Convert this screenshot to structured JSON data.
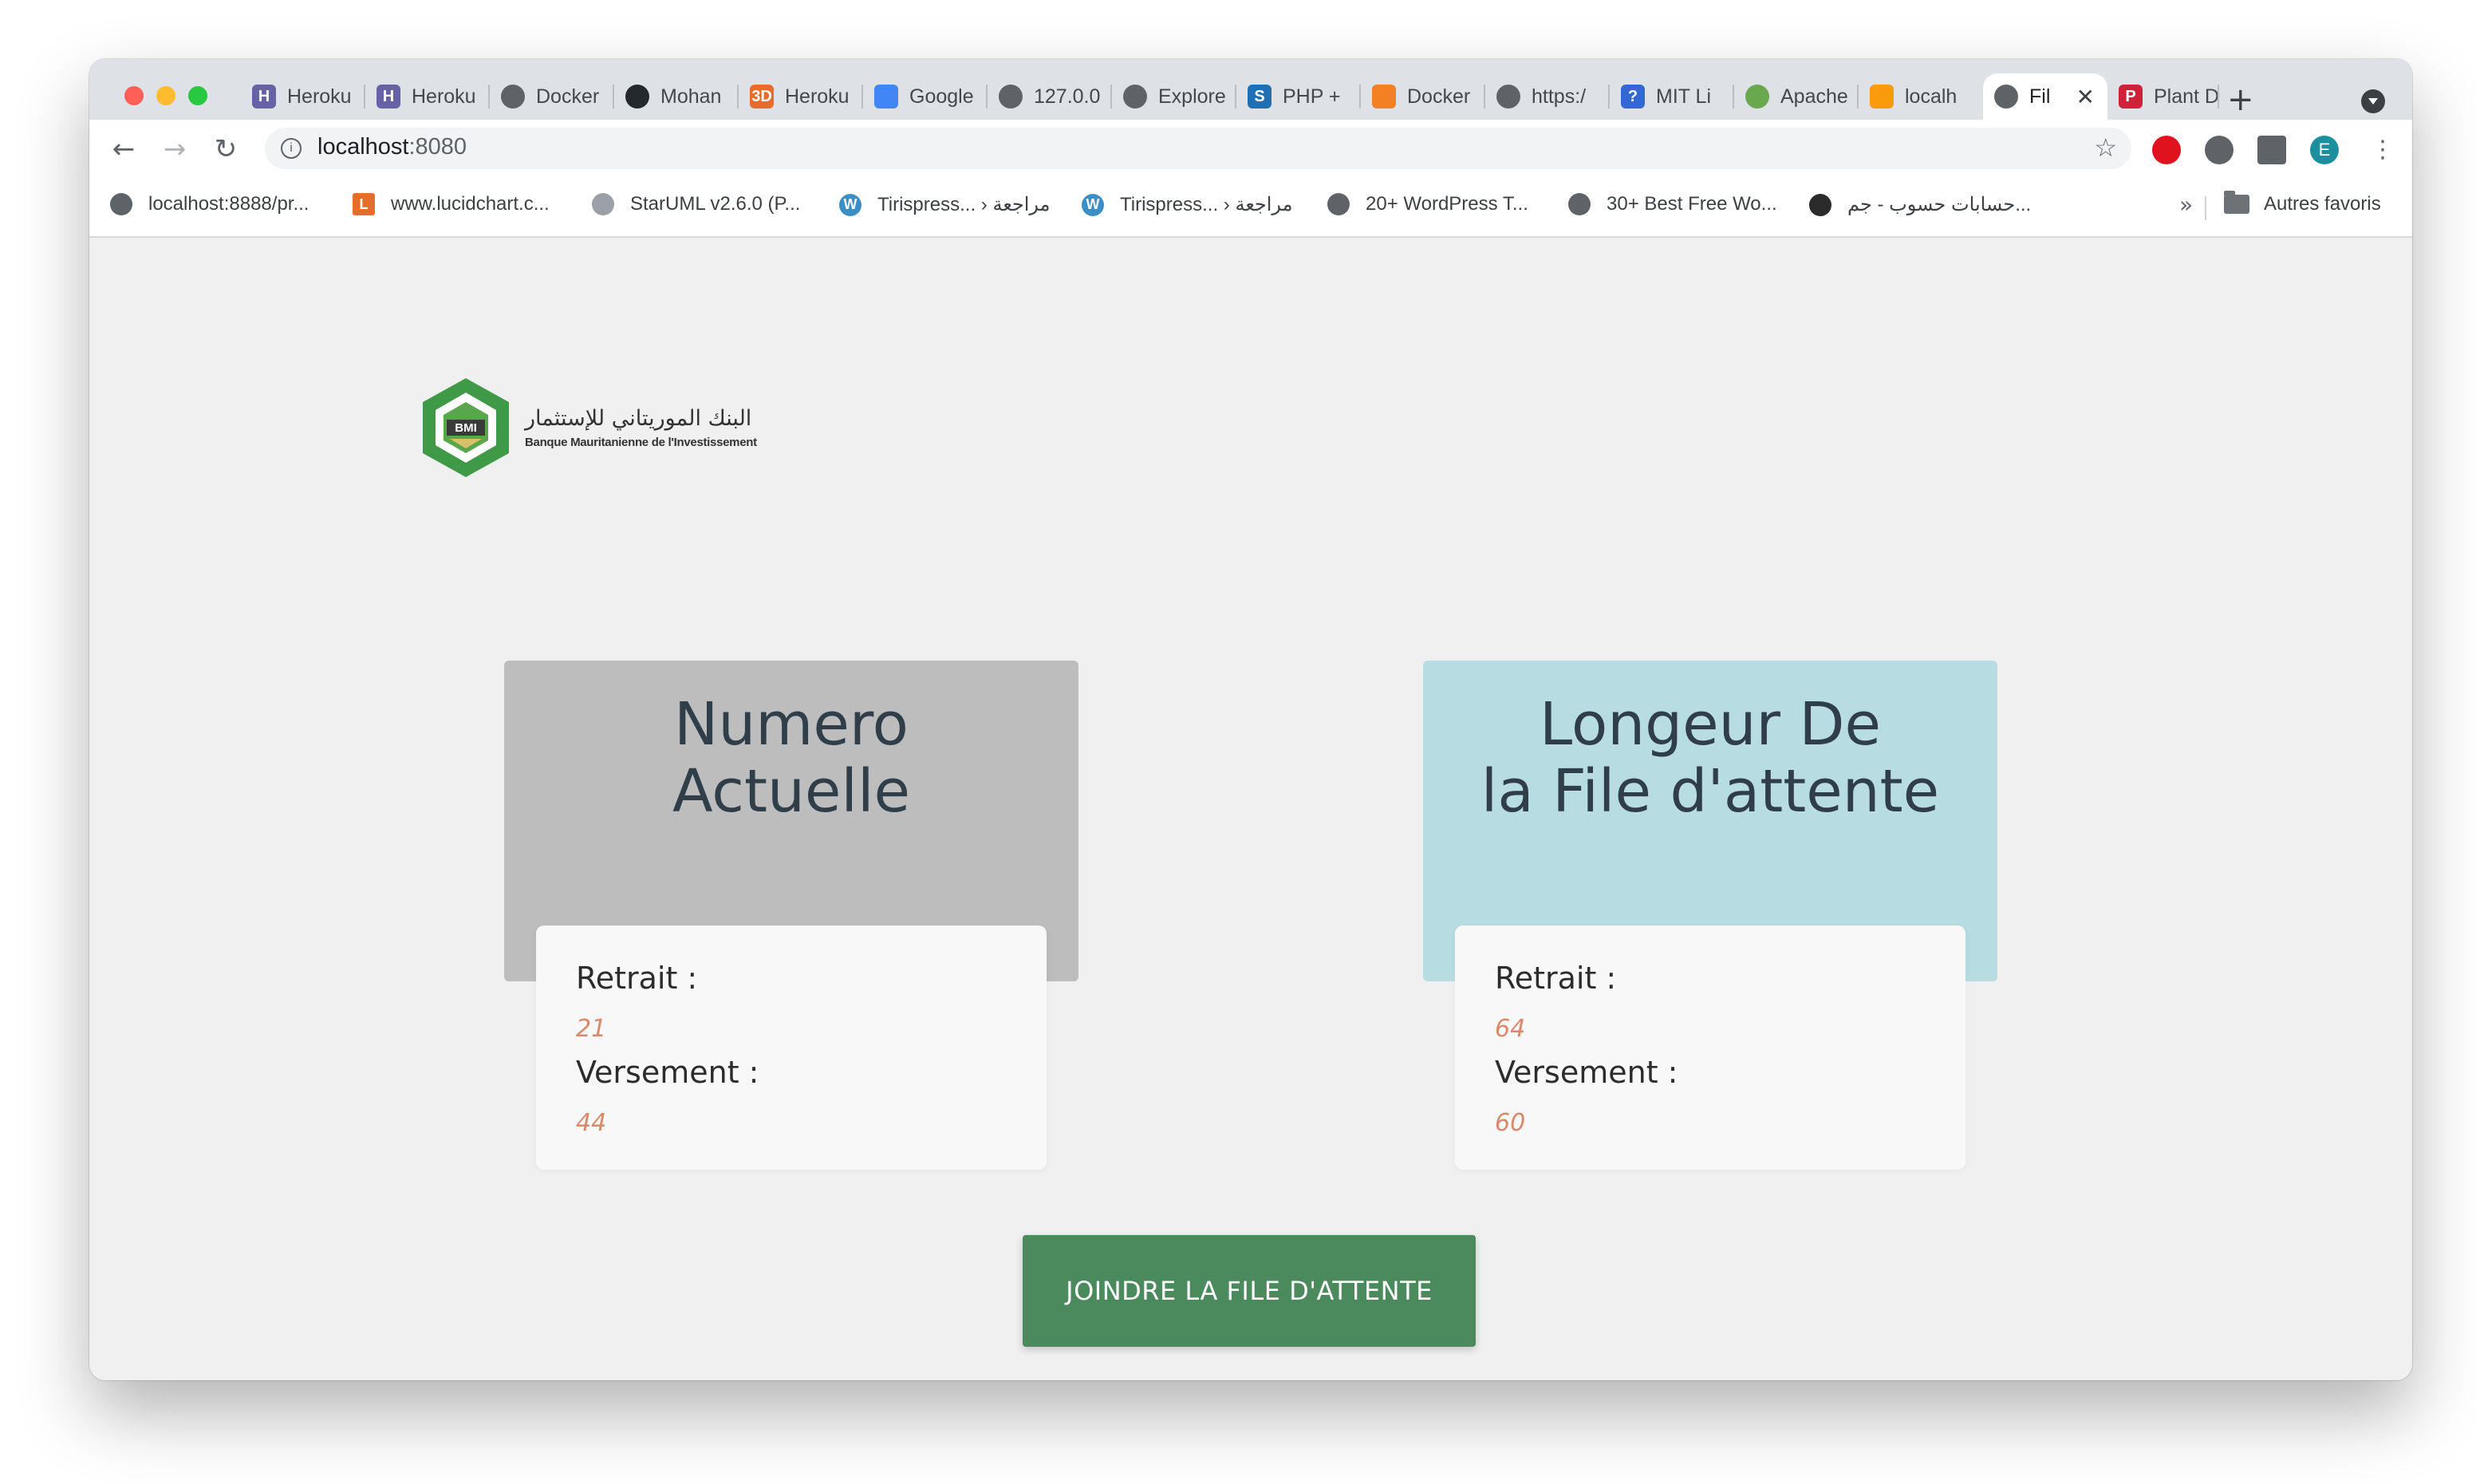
{
  "browser": {
    "tabs": [
      {
        "title": "Heroku",
        "icon": "heroku-icon",
        "color": "#6762a6"
      },
      {
        "title": "Heroku",
        "icon": "heroku-icon",
        "color": "#6762a6"
      },
      {
        "title": "Docker",
        "icon": "globe-icon",
        "color": "#5f6368"
      },
      {
        "title": "Mohan",
        "icon": "github-icon",
        "color": "#24292e"
      },
      {
        "title": "Heroku",
        "icon": "3d-icon",
        "color": "#e96b2c"
      },
      {
        "title": "Google",
        "icon": "google-icon",
        "color": "#4285f4"
      },
      {
        "title": "127.0.0",
        "icon": "globe-icon",
        "color": "#5f6368"
      },
      {
        "title": "Explore",
        "icon": "globe-icon",
        "color": "#5f6368"
      },
      {
        "title": "PHP +",
        "icon": "php-icon",
        "color": "#1f6fb5"
      },
      {
        "title": "Docker",
        "icon": "stack-icon",
        "color": "#f48024"
      },
      {
        "title": "https:/",
        "icon": "globe-icon",
        "color": "#5f6368"
      },
      {
        "title": "MIT Li",
        "icon": "mit-icon",
        "color": "#3367d6"
      },
      {
        "title": "Apache",
        "icon": "apache-icon",
        "color": "#6aa84f"
      },
      {
        "title": "localh",
        "icon": "pma-icon",
        "color": "#f89c0e"
      },
      {
        "title": "Fil",
        "icon": "globe-icon",
        "color": "#5f6368"
      },
      {
        "title": "Plant D",
        "icon": "plant-icon",
        "color": "#d0213a"
      }
    ],
    "active_tab_close": "✕",
    "new_tab": "+",
    "url_host": "localhost",
    "url_port": ":8080",
    "profile_initial": "E",
    "bookmarks": [
      {
        "title": "localhost:8888/pr...",
        "color": "#5f6368"
      },
      {
        "title": "www.lucidchart.c...",
        "color": "#e46f2b"
      },
      {
        "title": "StarUML v2.6.0 (P...",
        "color": "#9aa0a6"
      },
      {
        "title": "Tirispress... › مراجعة",
        "color": "#3b8fc6"
      },
      {
        "title": "Tirispress... › مراجعة",
        "color": "#3b8fc6"
      },
      {
        "title": "20+ WordPress T...",
        "color": "#5f6368"
      },
      {
        "title": "30+ Best Free Wo...",
        "color": "#5f6368"
      },
      {
        "title": "حسابات حسوب - جم...",
        "color": "#2b2b2b"
      }
    ],
    "bookmarks_more": "»",
    "other_bookmarks": "Autres favoris"
  },
  "logo": {
    "arabic": "البنك الموريتاني للإستثمار",
    "french": "Banque Mauritanienne de l'Investissement",
    "abbr": "BMI"
  },
  "cards": [
    {
      "title_line1": "Numero",
      "title_line2": "Actuelle",
      "retrait_label": "Retrait :",
      "retrait_value": "21",
      "versement_label": "Versement :",
      "versement_value": "44"
    },
    {
      "title_line1": "Longeur De",
      "title_line2": "la File d'attente",
      "retrait_label": "Retrait :",
      "retrait_value": "64",
      "versement_label": "Versement :",
      "versement_value": "60"
    }
  ],
  "cta": {
    "label": "JOINDRE LA FILE D'ATTENTE"
  },
  "colors": {
    "card_grey": "#bdbdbd",
    "card_teal": "#b7dde3",
    "button_green": "#4a8a5c",
    "value_orange": "#d9896a"
  }
}
